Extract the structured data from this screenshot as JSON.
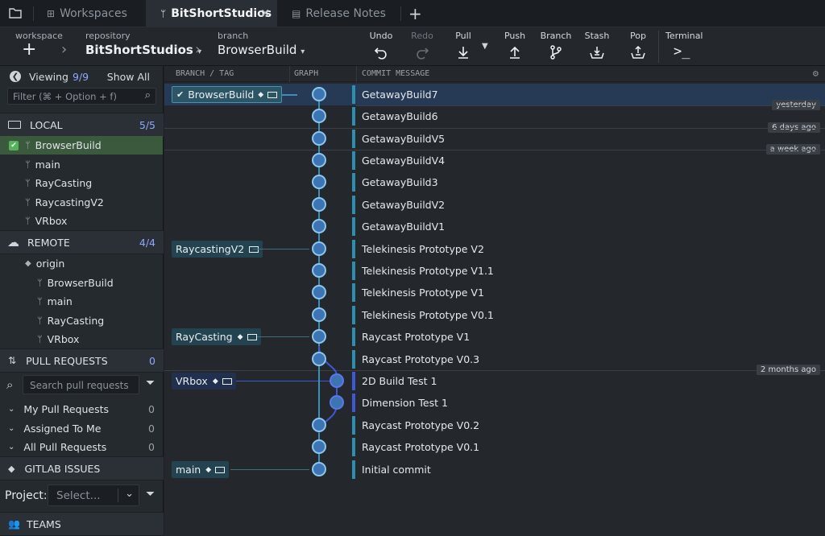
{
  "tabs": {
    "workspaces": "Workspaces",
    "repo": "BitShortStudios",
    "notes": "Release Notes"
  },
  "toolbar": {
    "workspace_label": "workspace",
    "repository_label": "repository",
    "repository_value": "BitShortStudios",
    "branch_label": "branch",
    "branch_value": "BrowserBuild",
    "actions": {
      "undo": "Undo",
      "redo": "Redo",
      "pull": "Pull",
      "push": "Push",
      "branch": "Branch",
      "stash": "Stash",
      "pop": "Pop",
      "terminal": "Terminal"
    }
  },
  "sidebar": {
    "viewing_label": "Viewing",
    "viewing_count": "9/9",
    "show_all": "Show All",
    "filter_placeholder": "Filter (⌘ + Option + f)",
    "local": {
      "title": "LOCAL",
      "count": "5/5",
      "branches": [
        "BrowserBuild",
        "main",
        "RayCasting",
        "RaycastingV2",
        "VRbox"
      ]
    },
    "remote": {
      "title": "REMOTE",
      "count": "4/4",
      "origin": "origin",
      "branches": [
        "BrowserBuild",
        "main",
        "RayCasting",
        "VRbox"
      ]
    },
    "pull_requests": {
      "title": "PULL REQUESTS",
      "count": "0",
      "search_placeholder": "Search pull requests",
      "groups": [
        {
          "label": "My Pull Requests",
          "count": "0"
        },
        {
          "label": "Assigned To Me",
          "count": "0"
        },
        {
          "label": "All Pull Requests",
          "count": "0"
        }
      ]
    },
    "gitlab": {
      "title": "GITLAB ISSUES",
      "project_label": "Project:",
      "project_placeholder": "Select..."
    },
    "teams": {
      "title": "TEAMS"
    }
  },
  "graph": {
    "headers": {
      "branch_tag": "BRANCH / TAG",
      "graph": "GRAPH",
      "commit_message": "COMMIT MESSAGE"
    },
    "commits": [
      {
        "message": "GetawayBuild7"
      },
      {
        "message": "GetawayBuild6"
      },
      {
        "message": "GetawayBuildV5"
      },
      {
        "message": "GetawayBuildV4"
      },
      {
        "message": "GetawayBuild3"
      },
      {
        "message": "GetawayBuildV2"
      },
      {
        "message": "GetawayBuildV1"
      },
      {
        "message": "Telekinesis Prototype V2"
      },
      {
        "message": "Telekinesis Prototype V1.1"
      },
      {
        "message": "Telekinesis Prototype V1"
      },
      {
        "message": "Telekinesis Prototype V0.1"
      },
      {
        "message": "Raycast Prototype V1"
      },
      {
        "message": "Raycast Prototype V0.3"
      },
      {
        "message": "2D Build Test 1"
      },
      {
        "message": "Dimension Test 1"
      },
      {
        "message": "Raycast Prototype V0.2"
      },
      {
        "message": "Raycast Prototype V0.1"
      },
      {
        "message": "Initial commit"
      }
    ],
    "branch_labels": {
      "browserbuild": "BrowserBuild",
      "raycastingv2": "RaycastingV2",
      "raycasting": "RayCasting",
      "vrbox": "VRbox",
      "main": "main"
    },
    "dates": {
      "yesterday": "yesterday",
      "six_days": "6 days ago",
      "week": "a week ago",
      "two_months": "2 months ago"
    }
  },
  "colors": {
    "accent": "#8fa7ff",
    "selected_row": "#283b55",
    "branch_line": "#3d8fb8",
    "active_branch": "#3a5a3b"
  }
}
